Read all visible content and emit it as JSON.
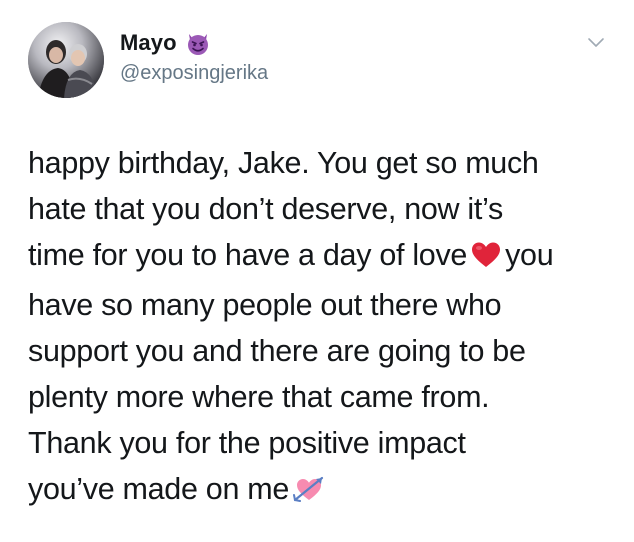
{
  "tweet": {
    "author": {
      "display_name": "Mayo",
      "handle": "@exposingjerika",
      "name_emoji": "smiling-face-with-horns-icon"
    },
    "text_lines": [
      "happy birthday, Jake. You get so much",
      "hate that you don’t deserve, now it’s",
      "time for you to have a day of love",
      "you",
      "have so many people out there who",
      "support you and there are going to be",
      "plenty more where that came from.",
      "Thank you for the positive impact",
      "you’ve made on me"
    ],
    "emojis": [
      "red-heart-icon",
      "heart-with-arrow-icon"
    ],
    "colors": {
      "text": "#14171a",
      "secondary": "#657786",
      "devil_purple": "#9b59b6",
      "heart_red": "#e0243a",
      "heart_pink": "#f78bb0"
    }
  }
}
